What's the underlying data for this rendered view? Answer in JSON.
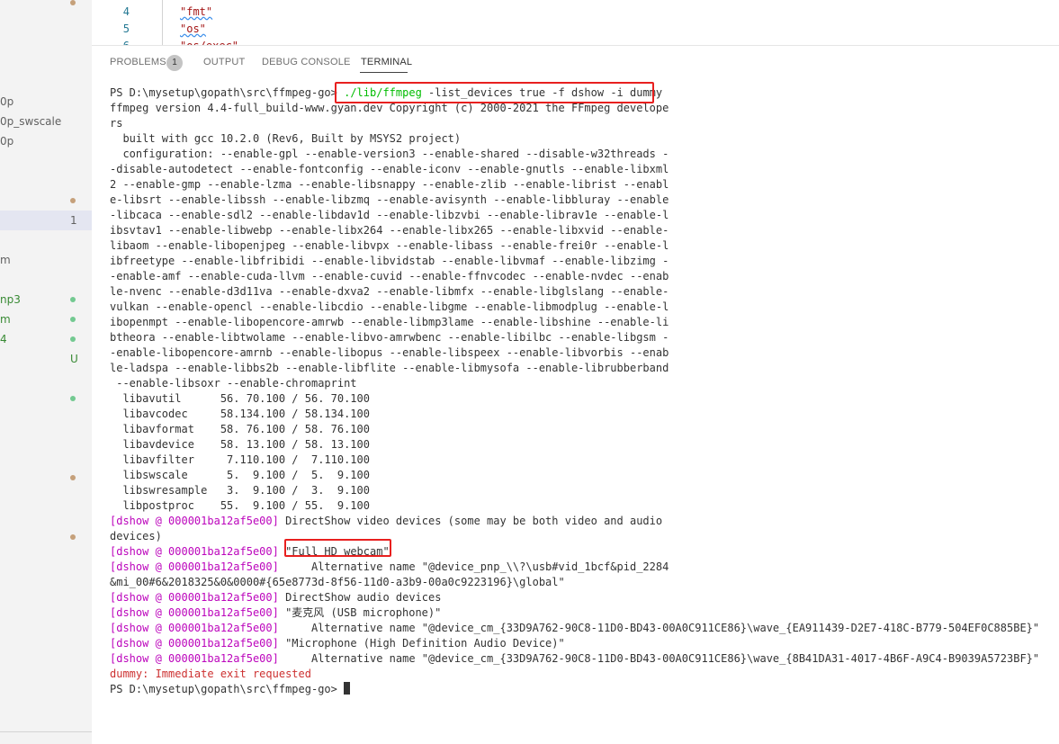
{
  "sidebar": {
    "items": [
      {
        "label": "",
        "dot": "#c5a07a",
        "badge": ""
      },
      {
        "label": "0p",
        "dot": "",
        "badge": ""
      },
      {
        "label": "0p_swscale",
        "dot": "",
        "badge": ""
      },
      {
        "label": "0p",
        "dot": "",
        "badge": ""
      },
      {
        "label": "",
        "dot": "#c5a07a",
        "badge": ""
      },
      {
        "label": "",
        "dot": "",
        "badge": "1"
      },
      {
        "label": "m",
        "dot": "",
        "badge": ""
      },
      {
        "label": "np3",
        "dot": "#73c991",
        "badge": ""
      },
      {
        "label": "m",
        "dot": "#73c991",
        "badge": ""
      },
      {
        "label": "4",
        "dot": "#73c991",
        "badge": ""
      },
      {
        "label": "",
        "dot": "",
        "badge": "U"
      },
      {
        "label": "",
        "dot": "#73c991",
        "badge": ""
      },
      {
        "label": "",
        "dot": "#c5a07a",
        "badge": ""
      },
      {
        "label": "",
        "dot": "#c5a07a",
        "badge": ""
      }
    ]
  },
  "editor": {
    "lines": [
      {
        "num": "4",
        "text": "\"fmt\""
      },
      {
        "num": "5",
        "text": "\"os\""
      },
      {
        "num": "6",
        "text": "\"os/exec\""
      }
    ]
  },
  "panel": {
    "tabs": [
      "PROBLEMS",
      "OUTPUT",
      "DEBUG CONSOLE",
      "TERMINAL"
    ],
    "problems_count": "1",
    "active_tab": "TERMINAL"
  },
  "terminal": {
    "prompt": "PS D:\\mysetup\\gopath\\src\\ffmpeg-go>",
    "command_exe": "./lib/ffmpeg",
    "command_args": " -list_devices true -f dshow -i dummy",
    "tag": "[dshow @ 000001ba12af5e00]",
    "output": [
      "ffmpeg version 4.4-full_build-www.gyan.dev Copyright (c) 2000-2021 the FFmpeg develope",
      "rs",
      "  built with gcc 10.2.0 (Rev6, Built by MSYS2 project)",
      "  configuration: --enable-gpl --enable-version3 --enable-shared --disable-w32threads -",
      "-disable-autodetect --enable-fontconfig --enable-iconv --enable-gnutls --enable-libxml",
      "2 --enable-gmp --enable-lzma --enable-libsnappy --enable-zlib --enable-librist --enabl",
      "e-libsrt --enable-libssh --enable-libzmq --enable-avisynth --enable-libbluray --enable",
      "-libcaca --enable-sdl2 --enable-libdav1d --enable-libzvbi --enable-librav1e --enable-l",
      "ibsvtav1 --enable-libwebp --enable-libx264 --enable-libx265 --enable-libxvid --enable-",
      "libaom --enable-libopenjpeg --enable-libvpx --enable-libass --enable-frei0r --enable-l",
      "ibfreetype --enable-libfribidi --enable-libvidstab --enable-libvmaf --enable-libzimg -",
      "-enable-amf --enable-cuda-llvm --enable-cuvid --enable-ffnvcodec --enable-nvdec --enab",
      "le-nvenc --enable-d3d11va --enable-dxva2 --enable-libmfx --enable-libglslang --enable-",
      "vulkan --enable-opencl --enable-libcdio --enable-libgme --enable-libmodplug --enable-l",
      "ibopenmpt --enable-libopencore-amrwb --enable-libmp3lame --enable-libshine --enable-li",
      "btheora --enable-libtwolame --enable-libvo-amrwbenc --enable-libilbc --enable-libgsm -",
      "-enable-libopencore-amrnb --enable-libopus --enable-libspeex --enable-libvorbis --enab",
      "le-ladspa --enable-libbs2b --enable-libflite --enable-libmysofa --enable-librubberband",
      " --enable-libsoxr --enable-chromaprint",
      "  libavutil      56. 70.100 / 56. 70.100",
      "  libavcodec     58.134.100 / 58.134.100",
      "  libavformat    58. 76.100 / 58. 76.100",
      "  libavdevice    58. 13.100 / 58. 13.100",
      "  libavfilter     7.110.100 /  7.110.100",
      "  libswscale      5.  9.100 /  5.  9.100",
      "  libswresample   3.  9.100 /  3.  9.100",
      "  libpostproc    55.  9.100 / 55.  9.100"
    ],
    "dshow_lines": [
      {
        "text": " DirectShow video devices (some may be both video and audio",
        "indent": false
      },
      {
        "text": "devices)",
        "indent": true,
        "no_tag": true
      },
      {
        "text": " \"Full HD webcam\"",
        "indent": false
      },
      {
        "text": "     Alternative name \"@device_pnp_\\\\?\\usb#vid_1bcf&pid_2284",
        "indent": false
      },
      {
        "text": "&mi_00#6&2018325&0&0000#{65e8773d-8f56-11d0-a3b9-00a0c9223196}\\global\"",
        "indent": true,
        "no_tag": true
      },
      {
        "text": " DirectShow audio devices",
        "indent": false
      },
      {
        "text": " \"麦克风 (USB microphone)\"",
        "indent": false
      },
      {
        "text": "     Alternative name \"@device_cm_{33D9A762-90C8-11D0-BD43-00A0C911CE86}\\wave_{EA911439-D2E7-418C-B779-504EF0C885BE}\"",
        "indent": false
      },
      {
        "text": " \"Microphone (High Definition Audio Device)\"",
        "indent": false
      },
      {
        "text": "     Alternative name \"@device_cm_{33D9A762-90C8-11D0-BD43-00A0C911CE86}\\wave_{8B41DA31-4017-4B6F-A9C4-B9039A5723BF}\"",
        "indent": false
      }
    ],
    "exit_line": "dummy: Immediate exit requested",
    "final_prompt": "PS D:\\mysetup\\gopath\\src\\ffmpeg-go> ",
    "highlight_color": "#e8201f"
  }
}
